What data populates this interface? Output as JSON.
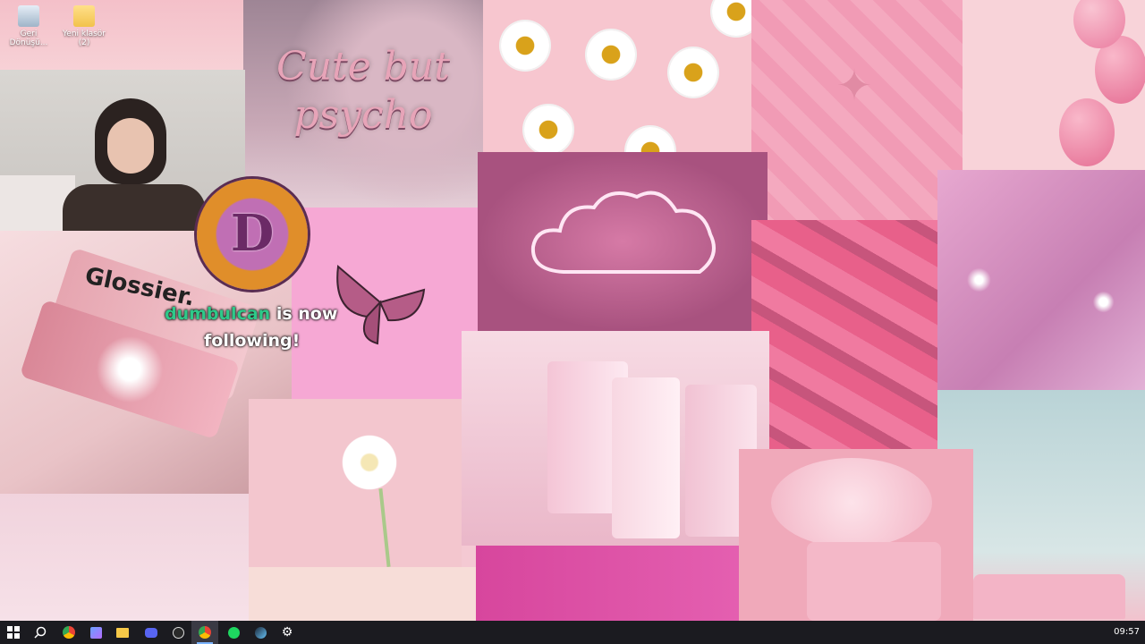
{
  "desktop": {
    "icons": [
      {
        "label": "Geri Dönüşü...",
        "name": "recycle-bin"
      },
      {
        "label": "Yeni klasör (2)",
        "name": "folder"
      }
    ]
  },
  "wallpaper": {
    "cute_text_line1": "Cute but",
    "cute_text_line2": "psycho",
    "glossier_label": "Glossier."
  },
  "stream_overlay": {
    "follower_name": "dumbulcan",
    "alert_suffix": "is now",
    "alert_line2": "following!",
    "badge_letter": "D"
  },
  "taskbar": {
    "items": [
      "start",
      "search",
      "chrome",
      "app",
      "file-explorer",
      "discord",
      "obs",
      "chrome-active",
      "spotify",
      "steam",
      "settings"
    ],
    "clock": "09:57"
  },
  "colors": {
    "taskbar": "#1b1b20",
    "alert_name": "#2ec989",
    "pink_accent": "#f08fb6"
  }
}
